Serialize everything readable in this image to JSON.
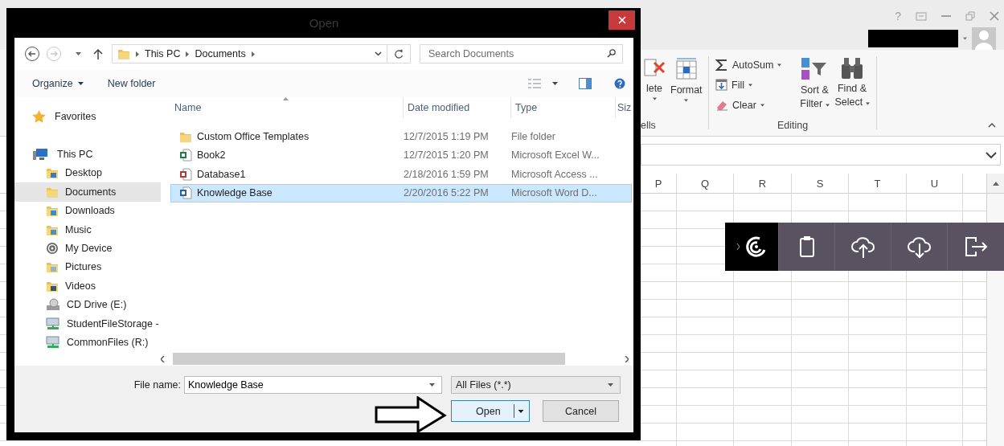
{
  "excel": {
    "help": "?",
    "cells_group": {
      "buttons": [
        {
          "label": "lete",
          "kind": "delete"
        },
        {
          "label": "Format",
          "kind": "format"
        }
      ],
      "label": "ells"
    },
    "editing_group": {
      "small": [
        {
          "label": "AutoSum",
          "kind": "autosum"
        },
        {
          "label": "Fill",
          "kind": "fill"
        },
        {
          "label": "Clear",
          "kind": "clear"
        }
      ],
      "large": [
        {
          "lines": [
            "Sort &",
            "Filter"
          ],
          "kind": "sort"
        },
        {
          "lines": [
            "Find &",
            "Select"
          ],
          "kind": "find"
        }
      ],
      "label": "Editing"
    },
    "columns": [
      "P",
      "Q",
      "R",
      "S",
      "T",
      "U"
    ]
  },
  "side_toolbar": [
    {
      "kind": "brand",
      "selected": true
    },
    {
      "kind": "clipboard",
      "selected": false
    },
    {
      "kind": "upload",
      "selected": false
    },
    {
      "kind": "download",
      "selected": false
    },
    {
      "kind": "exit",
      "selected": false
    }
  ],
  "dialog": {
    "title": "Open",
    "path": [
      "This PC",
      "Documents"
    ],
    "search": {
      "placeholder": "Search Documents"
    },
    "organize": "Organize",
    "new_folder": "New folder",
    "nav": [
      {
        "label": "Favorites",
        "kind": "star",
        "selected": false
      },
      {
        "label": "This PC",
        "kind": "pc",
        "selected": false,
        "children": [
          {
            "label": "Desktop",
            "kind": "desktop",
            "selected": false
          },
          {
            "label": "Documents",
            "kind": "documents",
            "selected": true
          },
          {
            "label": "Downloads",
            "kind": "downloads",
            "selected": false
          },
          {
            "label": "Music",
            "kind": "music",
            "selected": false
          },
          {
            "label": "My Device",
            "kind": "device",
            "selected": false
          },
          {
            "label": "Pictures",
            "kind": "pictures",
            "selected": false
          },
          {
            "label": "Videos",
            "kind": "videos",
            "selected": false
          },
          {
            "label": "CD Drive (E:)",
            "kind": "cd",
            "selected": false
          },
          {
            "label": "StudentFileStorage -",
            "kind": "network",
            "selected": false
          },
          {
            "label": "CommonFiles (R:)",
            "kind": "network",
            "selected": false
          }
        ]
      }
    ],
    "columns": [
      "Name",
      "Date modified",
      "Type",
      "Siz"
    ],
    "files": [
      {
        "name": "Custom Office Templates",
        "kind": "folder",
        "date": "12/7/2015 1:19 PM",
        "type": "File folder",
        "selected": false
      },
      {
        "name": "Book2",
        "kind": "excel",
        "date": "12/7/2015 1:20 PM",
        "type": "Microsoft Excel W...",
        "selected": false
      },
      {
        "name": "Database1",
        "kind": "access",
        "date": "2/18/2016 1:59 PM",
        "type": "Microsoft Access ...",
        "selected": false
      },
      {
        "name": "Knowledge Base",
        "kind": "word",
        "date": "2/20/2016 5:22 PM",
        "type": "Microsoft Word D...",
        "selected": true
      }
    ],
    "file_name": {
      "label": "File name:",
      "value": "Knowledge Base"
    },
    "filter": {
      "value": "All Files (*.*)"
    },
    "open": "Open",
    "cancel": "Cancel"
  }
}
